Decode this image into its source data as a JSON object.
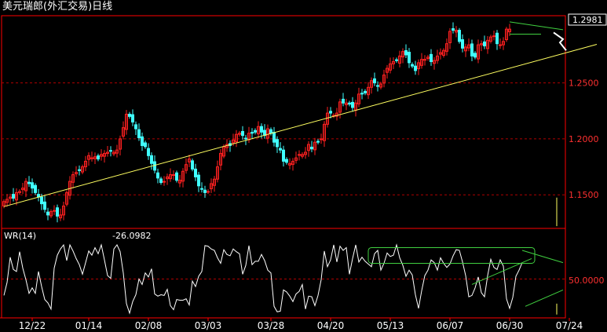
{
  "title": "美元瑞郎(外汇交易)日线",
  "price_box_value": "1.2981",
  "indicator": {
    "name": "WR(14)",
    "value": "-26.0982",
    "level_label": "50.0000"
  },
  "colors": {
    "background": "#000000",
    "frame": "#ff0000",
    "grid": "#b00000",
    "up": "#ff2020",
    "down": "#40ffff",
    "trend": "#ffff60",
    "channel": "#40d040",
    "wr_line": "#ffffff",
    "axis_text": "#ff3030",
    "date_text": "#ffffff"
  },
  "chart_data": [
    {
      "type": "candlestick",
      "title": "美元瑞郎(外汇交易)日线",
      "xlabel": "",
      "ylabel": "",
      "x_tick_labels": [
        "12/22",
        "01/14",
        "02/08",
        "03/03",
        "03/28",
        "04/20",
        "05/13",
        "06/07",
        "06/30",
        "07/24"
      ],
      "x_tick_index": [
        9,
        27,
        46,
        65,
        85,
        104,
        123,
        142,
        161,
        180
      ],
      "y_ticks": [
        1.15,
        1.2,
        1.25
      ],
      "y_tick_labels": [
        "1.1500",
        "1.2000",
        "1.2500"
      ],
      "ylim": [
        1.12,
        1.31
      ],
      "grid": true,
      "last_price": 1.2981,
      "close": [
        1.144,
        1.146,
        1.148,
        1.147,
        1.152,
        1.153,
        1.156,
        1.162,
        1.16,
        1.156,
        1.152,
        1.148,
        1.142,
        1.137,
        1.132,
        1.135,
        1.136,
        1.131,
        1.132,
        1.14,
        1.152,
        1.162,
        1.168,
        1.17,
        1.172,
        1.175,
        1.18,
        1.185,
        1.183,
        1.184,
        1.182,
        1.186,
        1.187,
        1.188,
        1.189,
        1.188,
        1.19,
        1.2,
        1.21,
        1.222,
        1.22,
        1.215,
        1.209,
        1.201,
        1.194,
        1.193,
        1.185,
        1.178,
        1.172,
        1.165,
        1.161,
        1.162,
        1.166,
        1.168,
        1.168,
        1.163,
        1.163,
        1.171,
        1.177,
        1.182,
        1.173,
        1.166,
        1.158,
        1.155,
        1.152,
        1.153,
        1.16,
        1.164,
        1.175,
        1.187,
        1.193,
        1.195,
        1.194,
        1.199,
        1.204,
        1.205,
        1.203,
        1.2,
        1.205,
        1.205,
        1.206,
        1.211,
        1.206,
        1.203,
        1.209,
        1.205,
        1.197,
        1.193,
        1.19,
        1.18,
        1.179,
        1.178,
        1.18,
        1.183,
        1.186,
        1.186,
        1.188,
        1.195,
        1.191,
        1.197,
        1.197,
        1.2,
        1.213,
        1.223,
        1.223,
        1.221,
        1.223,
        1.233,
        1.232,
        1.232,
        1.231,
        1.228,
        1.232,
        1.24,
        1.24,
        1.241,
        1.246,
        1.252,
        1.25,
        1.247,
        1.249,
        1.257,
        1.263,
        1.267,
        1.269,
        1.27,
        1.274,
        1.278,
        1.275,
        1.268,
        1.265,
        1.261,
        1.268,
        1.271,
        1.271,
        1.273,
        1.269,
        1.27,
        1.274,
        1.277,
        1.279,
        1.285,
        1.296,
        1.297,
        1.297,
        1.287,
        1.281,
        1.282,
        1.284,
        1.274,
        1.273,
        1.284,
        1.285,
        1.283,
        1.288,
        1.291,
        1.292,
        1.285,
        1.284,
        1.287,
        1.298,
        1.298
      ],
      "candle_step": 1
    },
    {
      "type": "line",
      "title": "WR(14)",
      "ylim": [
        0,
        100
      ],
      "level": 50,
      "last_value": -26.0982,
      "values": [
        26,
        45,
        82,
        64,
        61,
        90,
        66,
        49,
        29,
        37,
        29,
        61,
        39,
        20,
        15,
        6,
        66,
        85,
        94,
        100,
        77,
        100,
        91,
        80,
        71,
        57,
        74,
        91,
        85,
        96,
        87,
        100,
        78,
        55,
        51,
        94,
        100,
        90,
        59,
        14,
        0,
        17,
        27,
        50,
        42,
        59,
        53,
        65,
        28,
        25,
        27,
        26,
        35,
        11,
        5,
        20,
        19,
        19,
        21,
        12,
        47,
        39,
        54,
        61,
        99,
        98,
        94,
        92,
        81,
        73,
        93,
        86,
        84,
        94,
        90,
        87,
        57,
        70,
        99,
        71,
        76,
        76,
        86,
        77,
        63,
        59,
        10,
        2,
        3,
        34,
        31,
        25,
        17,
        28,
        32,
        42,
        6,
        25,
        24,
        11,
        26,
        49,
        91,
        68,
        78,
        100,
        75,
        98,
        92,
        96,
        57,
        80,
        100,
        75,
        82,
        76,
        72,
        68,
        87,
        92,
        63,
        73,
        88,
        83,
        85,
        100,
        81,
        70,
        54,
        63,
        56,
        27,
        7,
        33,
        55,
        63,
        78,
        74,
        63,
        81,
        73,
        67,
        72,
        84,
        93,
        92,
        75,
        55,
        24,
        26,
        37,
        53,
        30,
        24,
        55,
        79,
        67,
        64,
        78,
        69,
        21,
        7,
        23,
        54,
        63,
        74
      ],
      "channel_box": true
    }
  ]
}
